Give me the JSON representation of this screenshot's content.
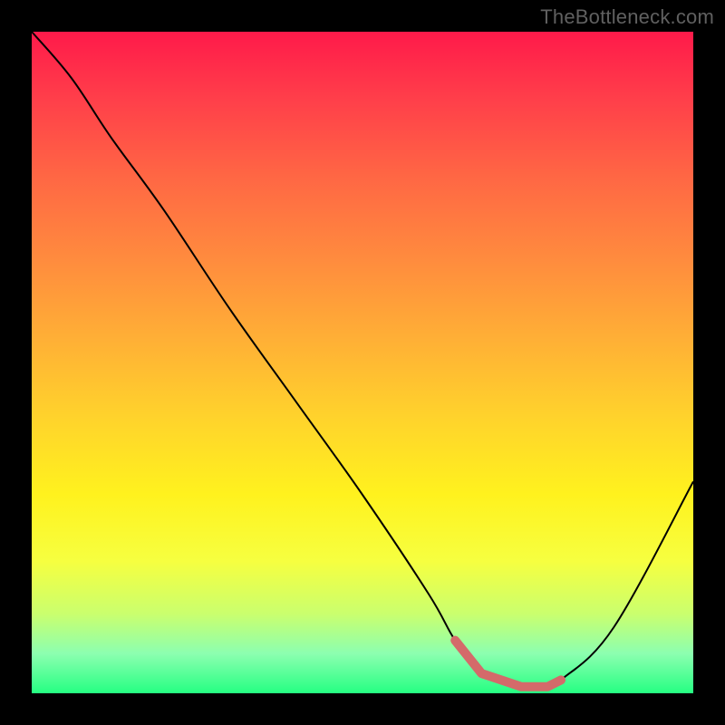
{
  "watermark": {
    "text": "TheBottleneck.com"
  },
  "chart_data": {
    "type": "line",
    "title": "",
    "xlabel": "",
    "ylabel": "",
    "xlim": [
      0,
      100
    ],
    "ylim": [
      0,
      100
    ],
    "series": [
      {
        "name": "curve",
        "color": "#000000",
        "x": [
          0,
          6,
          12,
          20,
          30,
          40,
          50,
          60,
          64,
          68,
          74,
          78,
          80,
          88,
          100
        ],
        "y": [
          100,
          93,
          84,
          73,
          58,
          44,
          30,
          15,
          8,
          3,
          1,
          1,
          2,
          10,
          32
        ]
      },
      {
        "name": "highlight",
        "color": "#d46a6a",
        "x": [
          64,
          68,
          74,
          78,
          80
        ],
        "y": [
          8,
          3,
          1,
          1,
          2
        ]
      }
    ]
  }
}
